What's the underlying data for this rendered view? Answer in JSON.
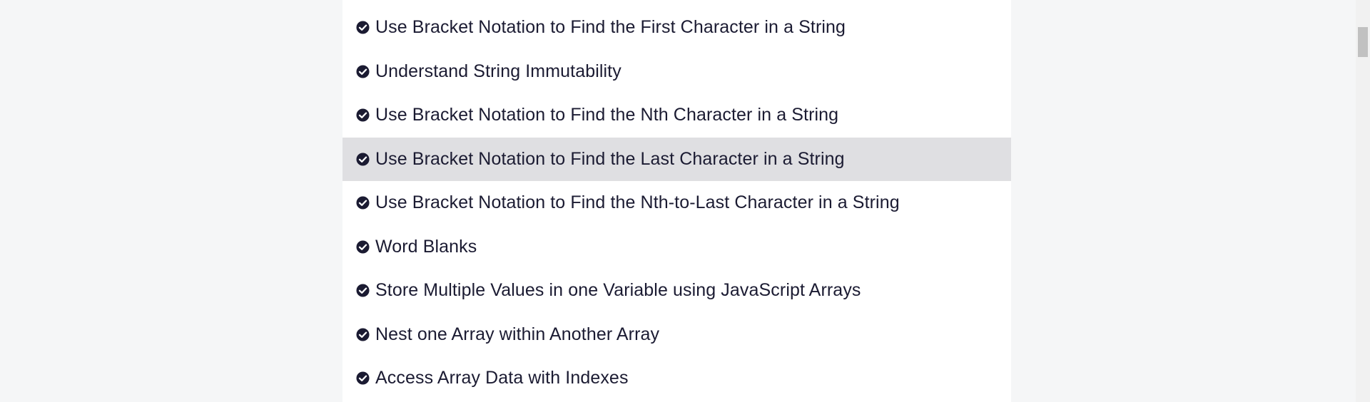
{
  "challenge_list": {
    "items": [
      {
        "label": "Use Bracket Notation to Find the First Character in a String",
        "completed": true
      },
      {
        "label": "Understand String Immutability",
        "completed": true
      },
      {
        "label": "Use Bracket Notation to Find the Nth Character in a String",
        "completed": true
      },
      {
        "label": "Use Bracket Notation to Find the Last Character in a String",
        "completed": true,
        "highlighted": true
      },
      {
        "label": "Use Bracket Notation to Find the Nth-to-Last Character in a String",
        "completed": true
      },
      {
        "label": "Word Blanks",
        "completed": true
      },
      {
        "label": "Store Multiple Values in one Variable using JavaScript Arrays",
        "completed": true
      },
      {
        "label": "Nest one Array within Another Array",
        "completed": true
      },
      {
        "label": "Access Array Data with Indexes",
        "completed": true
      }
    ]
  },
  "icons": {
    "completed": "check-circle-icon"
  },
  "colors": {
    "page_background": "#f5f6f7",
    "panel_background": "#ffffff",
    "highlight_background": "#dfdfe2",
    "text": "#1b1b32"
  }
}
